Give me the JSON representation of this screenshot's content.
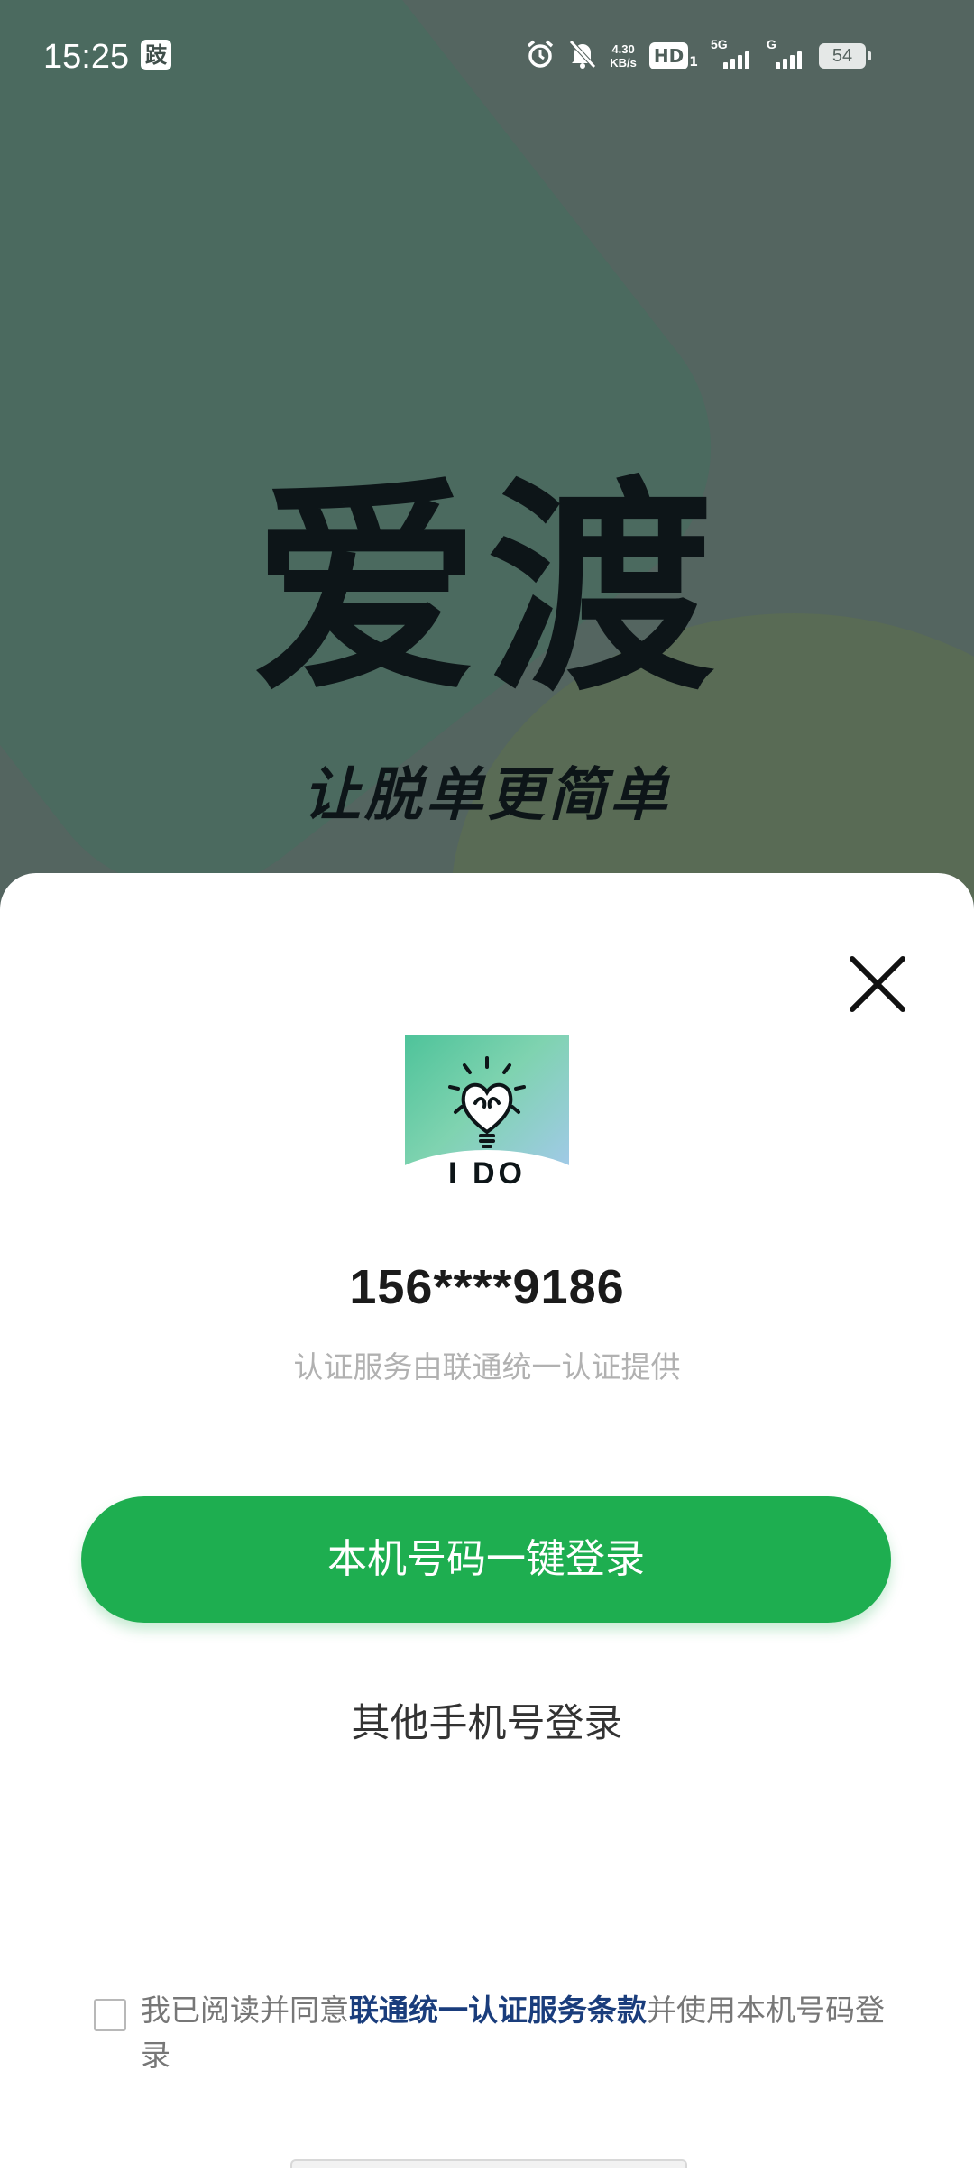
{
  "status_bar": {
    "time": "15:25",
    "notification_icon": "跂",
    "net_speed_value": "4.30",
    "net_speed_unit": "KB/s",
    "hd_label": "HD",
    "sim1_index": "1",
    "signal1_label": "5G",
    "signal2_label": "G",
    "battery_level": "54"
  },
  "splash": {
    "brand_title": "爱渡",
    "slogan": "让脱单更简单"
  },
  "login_sheet": {
    "logo_text": "I DO",
    "phone_number": "156****9186",
    "auth_provider_text": "认证服务由联通统一认证提供",
    "one_click_login_label": "本机号码一键登录",
    "other_login_label": "其他手机号登录",
    "agreement_prefix": "我已阅读并同意",
    "agreement_link": "联通统一认证服务条款",
    "agreement_suffix": "并使用本机号码登录"
  },
  "colors": {
    "primary_green": "#1eae50",
    "link_blue": "#1a3d7c",
    "splash_bg": "#546560"
  }
}
